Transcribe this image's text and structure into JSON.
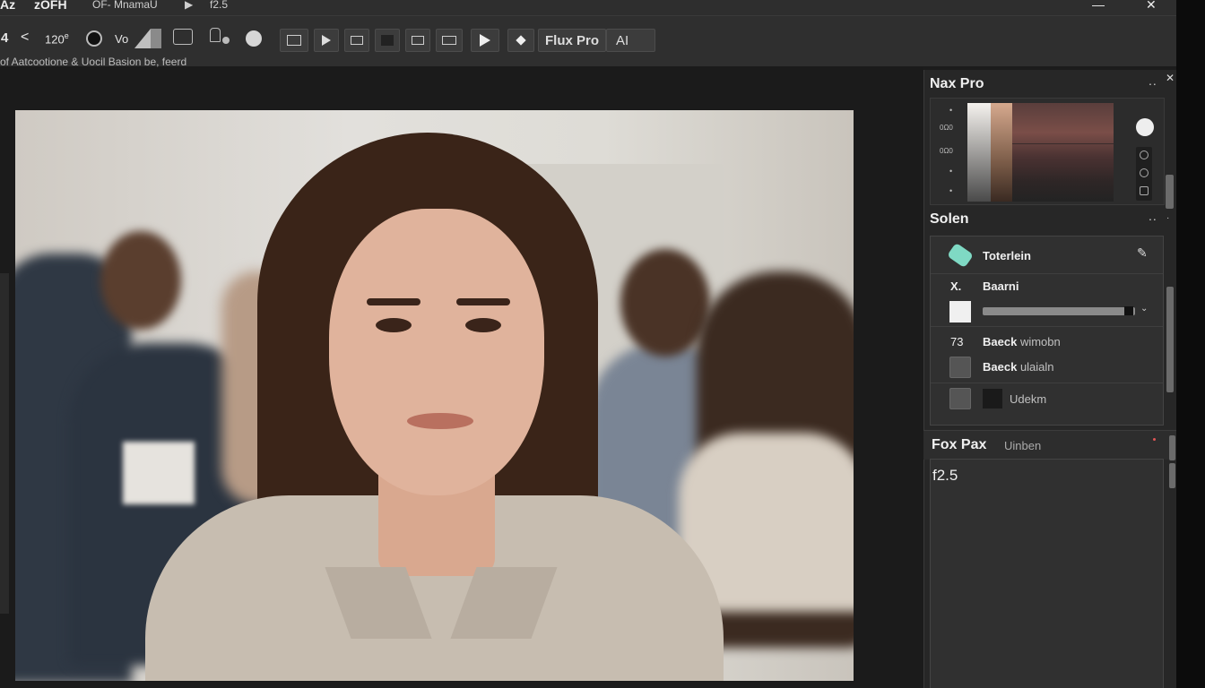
{
  "titlebar": {
    "left_a": "Az",
    "left_b": "zOFH",
    "menu_text": "OF- MnamaU",
    "play_glyph": "▶",
    "version": "f2.5",
    "minimize_glyph": "—",
    "close_glyph": "✕"
  },
  "toolbar": {
    "value_4": "4",
    "undo_glyph": "<",
    "zoom_value": "120",
    "zoom_sup": "e",
    "mode_label": "Vo",
    "model_label": "Flux Pro",
    "ai_label": "AI",
    "subtitle": "of Aatcootione  &  Uocil Basion be, feerd"
  },
  "panel": {
    "title": "Nax Pro",
    "dots": "..",
    "close_glyph": "✕",
    "swatch_labels": [
      "•",
      "0Ω0",
      "0Ω0",
      "•",
      "•"
    ],
    "colors": {
      "gradient_top": "#d8cfc6",
      "mid": "#7a5a50",
      "dark": "#2a2424",
      "accent": "#58c7b0"
    }
  },
  "layers": {
    "title": "Solen",
    "dots": "..",
    "rows": [
      {
        "prefix": "",
        "label": "Toterlein",
        "light": ""
      },
      {
        "prefix": "X.",
        "label": "Baarni",
        "light": ""
      },
      {
        "prefix": "",
        "label": "",
        "light": ""
      },
      {
        "prefix": "73",
        "label": "Baeck",
        "light": "wimobn"
      },
      {
        "prefix": "",
        "label": "Baeck",
        "light": "ulaialn"
      },
      {
        "prefix": "",
        "label": "",
        "light": "Udekm"
      }
    ]
  },
  "props": {
    "title_a": "Fox  Pax",
    "title_b": "Uinben",
    "value": "f2.5"
  }
}
